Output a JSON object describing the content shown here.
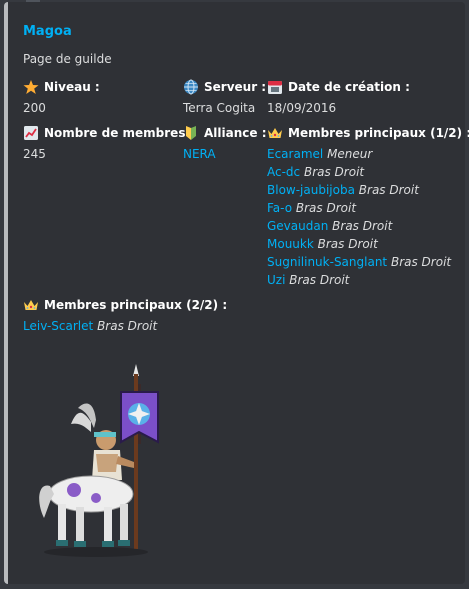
{
  "guild": {
    "name": "Magoa",
    "description": "Page de guilde"
  },
  "fields": {
    "niveau": {
      "label": "Niveau :",
      "value": "200",
      "icon": "star-icon"
    },
    "serveur": {
      "label": "Serveur :",
      "value": "Terra Cogita",
      "icon": "globe-icon"
    },
    "date": {
      "label": "Date de création :",
      "value": "18/09/2016",
      "icon": "calendar-icon"
    },
    "membres": {
      "label": "Nombre de membres :",
      "value": "245",
      "icon": "chart-icon"
    },
    "alliance": {
      "label": "Alliance :",
      "value": "NERA",
      "icon": "beginner-badge-icon"
    },
    "principaux1": {
      "label": "Membres principaux (1/2) :",
      "icon": "crown-icon",
      "members": [
        {
          "name": "Ecaramel",
          "role": "Meneur"
        },
        {
          "name": "Ac-dc",
          "role": "Bras Droit"
        },
        {
          "name": "Blow-jaubijoba",
          "role": "Bras Droit"
        },
        {
          "name": "Fa-o",
          "role": "Bras Droit"
        },
        {
          "name": "Gevaudan",
          "role": "Bras Droit"
        },
        {
          "name": "Mouukk",
          "role": "Bras Droit"
        },
        {
          "name": "Sugnilinuk-Sanglant",
          "role": "Bras Droit"
        },
        {
          "name": "Uzi",
          "role": "Bras Droit"
        }
      ]
    },
    "principaux2": {
      "label": "Membres principaux (2/2) :",
      "icon": "crown-icon",
      "members": [
        {
          "name": "Leiv-Scarlet",
          "role": "Bras Droit"
        }
      ]
    }
  },
  "colors": {
    "link": "#00b0f4",
    "embed_border": "#b9bbbe",
    "background": "#36393f",
    "embed_bg": "#2f3136"
  }
}
